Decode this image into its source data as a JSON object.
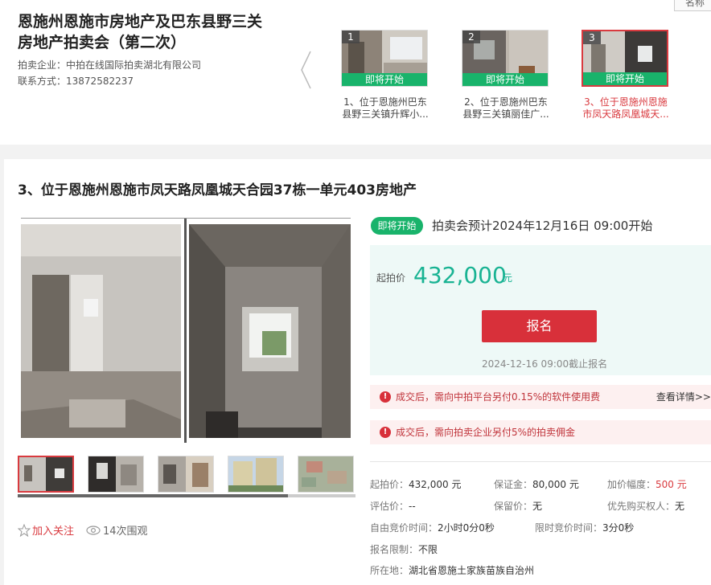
{
  "header": {
    "title_line1": "恩施州恩施市房地产及巴东县野三关",
    "title_line2": "房地产拍卖会（第二次）",
    "auctioneer_label": "拍卖企业：",
    "auctioneer": "中拍在线国际拍卖湖北有限公司",
    "contact_label": "联系方式：",
    "contact": "13872582237",
    "corner_tab": "名称"
  },
  "lots": [
    {
      "num": "1",
      "status": "即将开始",
      "caption_line1": "1、位于恩施州巴东",
      "caption_line2": "县野三关镇升辉小..."
    },
    {
      "num": "2",
      "status": "即将开始",
      "caption_line1": "2、位于恩施州巴东",
      "caption_line2": "县野三关镇丽佳广..."
    },
    {
      "num": "3",
      "status": "即将开始",
      "caption_line1": "3、位于恩施州恩施",
      "caption_line2": "市凤天路凤凰城天..."
    }
  ],
  "item": {
    "title": "3、位于恩施州恩施市凤天路凤凰城天合园37栋一单元403房地产",
    "status": "即将开始",
    "start_text": "拍卖会预计2024年12月16日  09:00开始",
    "price_label": "起拍价",
    "price": "432,000",
    "price_unit": "元",
    "signup": "报名",
    "deadline": "2024-12-16 09:00截止报名",
    "notice1": "成交后，需向中拍平台另付0.15%的软件使用费",
    "notice1_more": "查看详情>>",
    "notice2": "成交后，需向拍卖企业另付5%的拍卖佣金",
    "follow": "加入关注",
    "views": "14次围观"
  },
  "details": {
    "start_price_label": "起拍价：",
    "start_price": "432,000 元",
    "deposit_label": "保证金：",
    "deposit": "80,000 元",
    "increment_label": "加价幅度：",
    "increment": "500 元",
    "appraisal_label": "评估价：",
    "appraisal": "--",
    "reserve_label": "保留价：",
    "reserve": "无",
    "priority_label": "优先购买权人：",
    "priority": "无",
    "free_bid_label": "自由竞价时间：",
    "free_bid": "2小时0分0秒",
    "limited_bid_label": "限时竞价时间：",
    "limited_bid": "3分0秒",
    "restriction_label": "报名限制：",
    "restriction": "不限",
    "location_label": "所在地：",
    "location": "湖北省恩施土家族苗族自治州"
  }
}
